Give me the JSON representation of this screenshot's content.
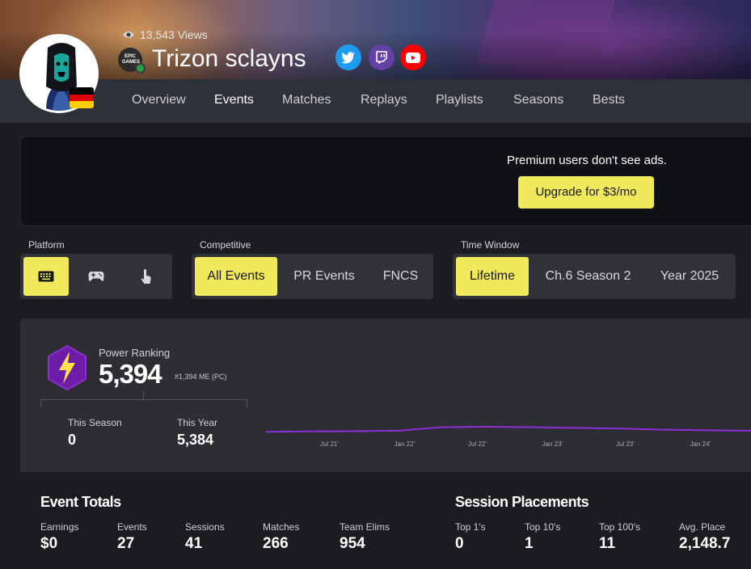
{
  "profile": {
    "views": "13,543 Views",
    "name": "Trizon sclayns",
    "epic_badge": "EPIC GAMES",
    "flag_colors": [
      "#000000",
      "#dd0000",
      "#ffce00"
    ]
  },
  "social": [
    {
      "name": "twitter-icon",
      "color": "#1d9bf0"
    },
    {
      "name": "twitch-icon",
      "color": "#6441a5"
    },
    {
      "name": "youtube-icon",
      "color": "#ff0000"
    }
  ],
  "nav": {
    "tabs": [
      "Overview",
      "Events",
      "Matches",
      "Replays",
      "Playlists",
      "Seasons",
      "Bests"
    ],
    "active": "Events"
  },
  "ad": {
    "message": "Premium users don't see ads.",
    "button": "Upgrade for $3/mo"
  },
  "filters": {
    "platform": {
      "label": "Platform",
      "options": [
        "keyboard-icon",
        "controller-icon",
        "touch-icon"
      ],
      "selected": "keyboard-icon"
    },
    "competitive": {
      "label": "Competitive",
      "options": [
        "All Events",
        "PR Events",
        "FNCS"
      ],
      "selected": "All Events"
    },
    "time_window": {
      "label": "Time Window",
      "options": [
        "Lifetime",
        "Ch.6 Season 2",
        "Year 2025"
      ],
      "selected": "Lifetime"
    }
  },
  "power_ranking": {
    "label": "Power Ranking",
    "value": "5,394",
    "rank": "#1,394 ME (PC)",
    "this_season_label": "This Season",
    "this_season_value": "0",
    "this_year_label": "This Year",
    "this_year_value": "5,384"
  },
  "chart_data": {
    "type": "line",
    "x": [
      "Jul 21'",
      "Jan 22'",
      "Jul 22'",
      "Jan 23'",
      "Jul 23'",
      "Jan 24'"
    ],
    "series": [
      {
        "values": [
          5200,
          5210,
          5215,
          5230,
          5330,
          5340,
          5330,
          5310,
          5290,
          5260,
          5240,
          5230
        ]
      }
    ],
    "color": "#8e2fd6"
  },
  "event_totals": {
    "title": "Event Totals",
    "stats": [
      {
        "label": "Earnings",
        "value": "$0"
      },
      {
        "label": "Events",
        "value": "27"
      },
      {
        "label": "Sessions",
        "value": "41"
      },
      {
        "label": "Matches",
        "value": "266"
      },
      {
        "label": "Team Elims",
        "value": "954"
      }
    ]
  },
  "session_placements": {
    "title": "Session Placements",
    "stats": [
      {
        "label": "Top 1's",
        "value": "0"
      },
      {
        "label": "Top 10's",
        "value": "1"
      },
      {
        "label": "Top 100's",
        "value": "11"
      },
      {
        "label": "Avg. Place",
        "value": "2,148.7"
      }
    ]
  }
}
